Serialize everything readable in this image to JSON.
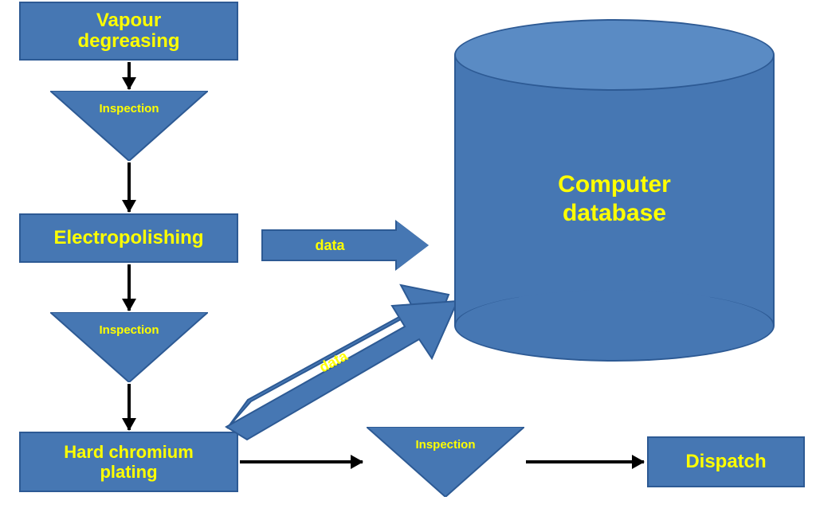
{
  "process": {
    "vapour_degreasing": "Vapour degreasing",
    "electropolishing": "Electropolishing",
    "hard_chromium_plating": "Hard chromium plating",
    "dispatch": "Dispatch"
  },
  "inspection_label": "Inspection",
  "data_label": "data",
  "database_label": "Computer database",
  "colors": {
    "fill": "#4677b3",
    "stroke": "#2d5a94",
    "text": "#ffff00"
  }
}
